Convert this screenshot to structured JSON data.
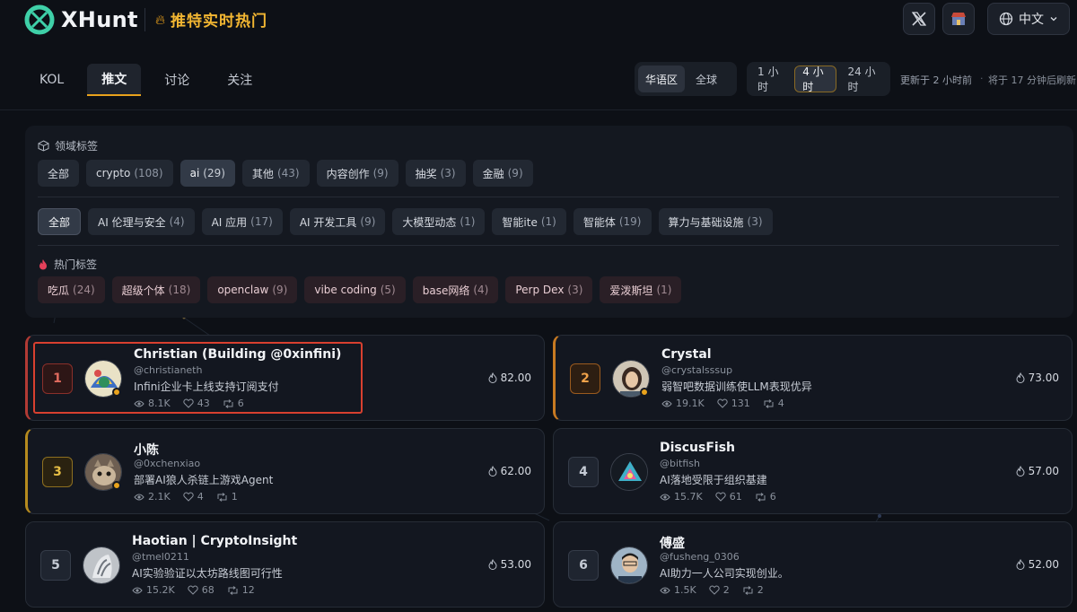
{
  "header": {
    "logo_text": "XHunt",
    "page_title": "推特实时热门",
    "language": "中文"
  },
  "tabs": [
    {
      "label": "KOL",
      "active": false
    },
    {
      "label": "推文",
      "active": true
    },
    {
      "label": "讨论",
      "active": false
    },
    {
      "label": "关注",
      "active": false
    }
  ],
  "region_toggle": [
    {
      "label": "华语区",
      "active": true
    },
    {
      "label": "全球",
      "active": false
    }
  ],
  "time_toggle": [
    {
      "label": "1 小时",
      "active": false
    },
    {
      "label": "4 小时",
      "active": true
    },
    {
      "label": "24 小时",
      "active": false
    }
  ],
  "update_status": "更新于 2 小时前",
  "refresh_status": "将于 17 分钟后刷新",
  "domain_tags": {
    "title": "领域标签",
    "row1": [
      {
        "label": "全部",
        "count": ""
      },
      {
        "label": "crypto",
        "count": "(108)"
      },
      {
        "label": "ai",
        "count": "(29)",
        "active": true
      },
      {
        "label": "其他",
        "count": "(43)"
      },
      {
        "label": "内容创作",
        "count": "(9)"
      },
      {
        "label": "抽奖",
        "count": "(3)"
      },
      {
        "label": "金融",
        "count": "(9)"
      }
    ],
    "row2": [
      {
        "label": "全部",
        "count": "",
        "active": true
      },
      {
        "label": "AI 伦理与安全",
        "count": "(4)"
      },
      {
        "label": "AI 应用",
        "count": "(17)"
      },
      {
        "label": "AI 开发工具",
        "count": "(9)"
      },
      {
        "label": "大模型动态",
        "count": "(1)"
      },
      {
        "label": "智能ite",
        "count": "(1)"
      },
      {
        "label": "智能体",
        "count": "(19)"
      },
      {
        "label": "算力与基础设施",
        "count": "(3)"
      }
    ]
  },
  "hot_tags": {
    "title": "热门标签",
    "items": [
      {
        "label": "吃瓜",
        "count": "(24)"
      },
      {
        "label": "超级个体",
        "count": "(18)"
      },
      {
        "label": "openclaw",
        "count": "(9)"
      },
      {
        "label": "vibe coding",
        "count": "(5)"
      },
      {
        "label": "base网络",
        "count": "(4)"
      },
      {
        "label": "Perp Dex",
        "count": "(3)"
      },
      {
        "label": "爱泼斯坦",
        "count": "(1)"
      }
    ]
  },
  "cards": [
    {
      "rank": "1",
      "name": "Christian (Building @0xinfini)",
      "handle": "@christianeth",
      "text": "Infini企业卡上线支持订阅支付",
      "views": "8.1K",
      "likes": "43",
      "retweets": "6",
      "score": "82.00"
    },
    {
      "rank": "2",
      "name": "Crystal",
      "handle": "@crystalsssup",
      "text": "弱智吧数据训练使LLM表现优异",
      "views": "19.1K",
      "likes": "131",
      "retweets": "4",
      "score": "73.00"
    },
    {
      "rank": "3",
      "name": "小陈",
      "handle": "@0xchenxiao",
      "text": "部署AI狼人杀链上游戏Agent",
      "views": "2.1K",
      "likes": "4",
      "retweets": "1",
      "score": "62.00"
    },
    {
      "rank": "4",
      "name": "DiscusFish",
      "handle": "@bitfish",
      "text": "AI落地受限于组织基建",
      "views": "15.7K",
      "likes": "61",
      "retweets": "6",
      "score": "57.00"
    },
    {
      "rank": "5",
      "name": "Haotian | CryptoInsight",
      "handle": "@tmel0211",
      "text": "AI实验验证以太坊路线图可行性",
      "views": "15.2K",
      "likes": "68",
      "retweets": "12",
      "score": "53.00"
    },
    {
      "rank": "6",
      "name": "傅盛",
      "handle": "@fusheng_0306",
      "text": "AI助力一人公司实现创业。",
      "views": "1.5K",
      "likes": "2",
      "retweets": "2",
      "score": "52.00"
    }
  ]
}
